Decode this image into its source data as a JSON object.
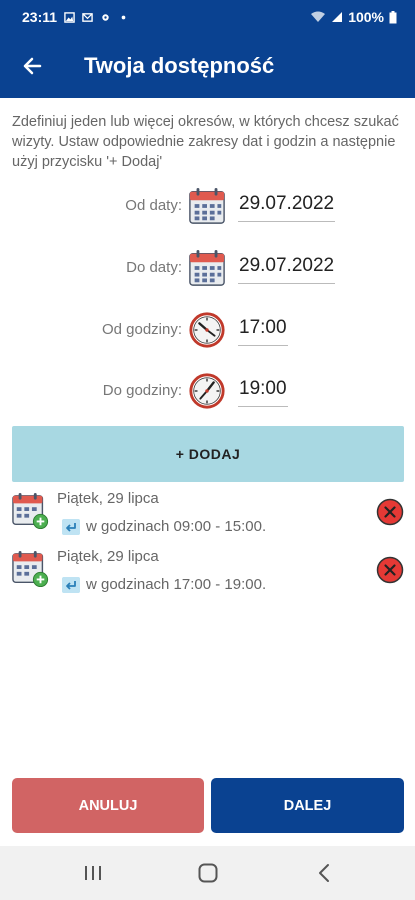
{
  "status_bar": {
    "time": "23:11",
    "battery": "100%"
  },
  "header": {
    "title": "Twoja dostępność",
    "back_icon": "arrow-left-icon"
  },
  "intro_text": "Zdefiniuj jeden lub więcej okresów, w których chcesz szukać wizyty. Ustaw odpowiednie zakresy dat i godzin a następnie użyj przycisku '+ Dodaj'",
  "form": {
    "from_date": {
      "label": "Od daty:",
      "value": "29.07.2022",
      "icon": "calendar-icon"
    },
    "to_date": {
      "label": "Do daty:",
      "value": "29.07.2022",
      "icon": "calendar-icon"
    },
    "from_time": {
      "label": "Od godziny:",
      "value": "17:00",
      "icon": "clock-icon"
    },
    "to_time": {
      "label": "Do godziny:",
      "value": "19:00",
      "icon": "clock-icon"
    }
  },
  "add_button": {
    "label": "+ DODAJ"
  },
  "periods": [
    {
      "day": "Piątek, 29 lipca",
      "hours": "w godzinach 09:00 - 15:00."
    },
    {
      "day": "Piątek, 29 lipca",
      "hours": "w godzinach 17:00 - 19:00."
    }
  ],
  "buttons": {
    "cancel": "ANULUJ",
    "next": "DALEJ"
  },
  "colors": {
    "primary": "#0a4291",
    "add_button": "#a8d8e2",
    "cancel_button": "#d16464",
    "remove_icon": "#e53935"
  }
}
